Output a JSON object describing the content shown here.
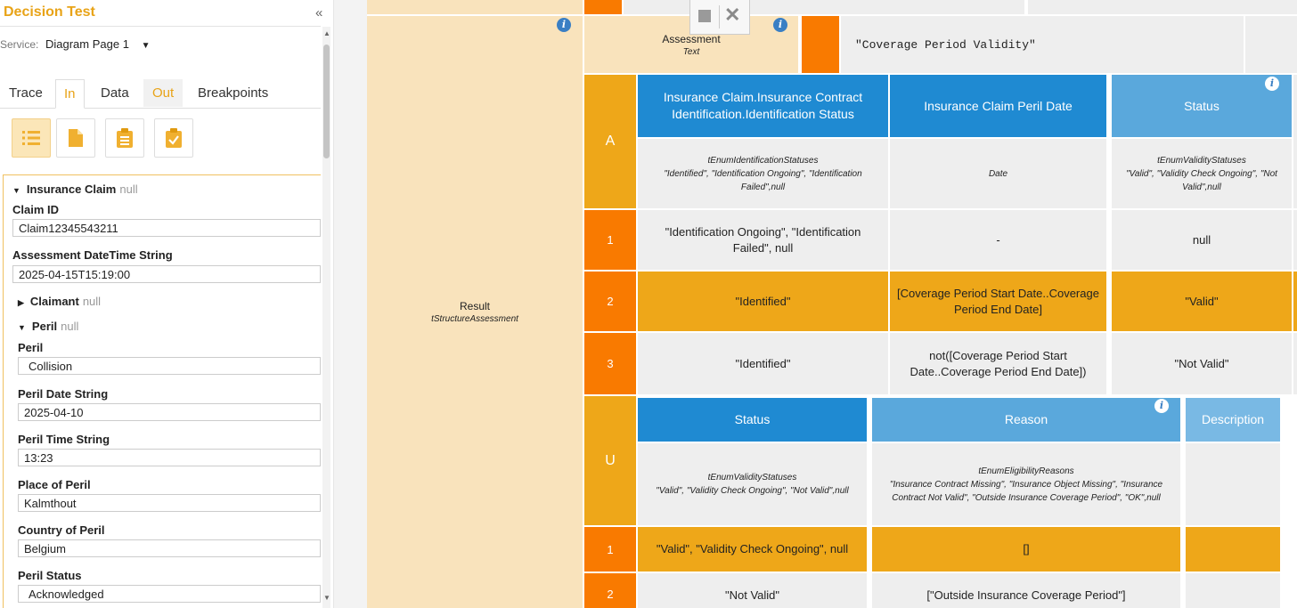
{
  "left_panel": {
    "title": "Decision Test",
    "collapse_icon": "«",
    "service_label": "Service:",
    "service_value": "Diagram Page 1",
    "tabs": [
      "Trace",
      "In",
      "Data",
      "Out",
      "Breakpoints"
    ],
    "active_tab": "In",
    "toolbar_icons": [
      "list-icon",
      "document-icon",
      "clipboard-icon",
      "clipboard-check-icon"
    ],
    "tree": {
      "root": {
        "label": "Insurance Claim",
        "null_text": "null"
      },
      "claim_id": {
        "label": "Claim ID",
        "value": "Claim12345543211"
      },
      "assessment_dt": {
        "label": "Assessment DateTime String",
        "value": "2025-04-15T15:19:00"
      },
      "claimant": {
        "label": "Claimant",
        "null_text": "null"
      },
      "peril": {
        "label": "Peril",
        "null_text": "null"
      },
      "peril_field": {
        "label": "Peril",
        "value": "Collision"
      },
      "peril_date": {
        "label": "Peril Date String",
        "value": "2025-04-10"
      },
      "peril_time": {
        "label": "Peril Time String",
        "value": "13:23"
      },
      "place": {
        "label": "Place of Peril",
        "value": "Kalmthout"
      },
      "country": {
        "label": "Country of Peril",
        "value": "Belgium"
      },
      "status": {
        "label": "Peril Status",
        "value": "Acknowledged"
      }
    }
  },
  "decision_table": {
    "assessment": {
      "label": "Assessment",
      "type": "Text",
      "value": "\"Coverage Period Validity\""
    },
    "result": {
      "label": "Result",
      "type": "tStructureAssessment"
    },
    "table_a": {
      "hit_policy": "A",
      "headers": [
        {
          "label": "Insurance Claim.Insurance Contract Identification.Identification Status",
          "type": "tEnumIdentificationStatuses\n\"Identified\", \"Identification Ongoing\", \"Identification Failed\",null"
        },
        {
          "label": "Insurance Claim Peril Date",
          "type": "Date"
        },
        {
          "label": "Status",
          "type": "tEnumValidityStatuses\n\"Valid\", \"Validity Check Ongoing\", \"Not Valid\",null"
        }
      ],
      "rows": [
        {
          "num": "1",
          "cells": [
            "\"Identification Ongoing\", \"Identification Failed\", null",
            "-",
            "null"
          ]
        },
        {
          "num": "2",
          "cells": [
            "\"Identified\"",
            "[Coverage Period Start Date..Coverage Period End Date]",
            "\"Valid\""
          ]
        },
        {
          "num": "3",
          "cells": [
            "\"Identified\"",
            "not([Coverage Period Start Date..Coverage Period End Date])",
            "\"Not Valid\""
          ]
        }
      ]
    },
    "table_u": {
      "hit_policy": "U",
      "headers": [
        {
          "label": "Status",
          "type": "tEnumValidityStatuses\n\"Valid\", \"Validity Check Ongoing\", \"Not Valid\",null"
        },
        {
          "label": "Reason",
          "type": "tEnumEligibilityReasons\n\"Insurance Contract Missing\", \"Insurance Object Missing\", \"Insurance Contract Not Valid\", \"Outside Insurance Coverage Period\", \"OK\",null"
        },
        {
          "label": "Description",
          "type": ""
        }
      ],
      "rows": [
        {
          "num": "1",
          "cells": [
            "\"Valid\", \"Validity Check Ongoing\", null",
            "[]",
            ""
          ]
        },
        {
          "num": "2",
          "cells": [
            "\"Not Valid\"",
            "[\"Outside Insurance Coverage Period\"]",
            ""
          ]
        }
      ]
    }
  },
  "colors": {
    "accent_gold": "#eea719",
    "orange": "#f97a00",
    "peach": "#f9e3bc",
    "header_blue": "#1f8ad2",
    "header_light_blue": "#5aa8dc",
    "cell_grey": "#eeeeee",
    "title_gold": "#e8a317"
  }
}
